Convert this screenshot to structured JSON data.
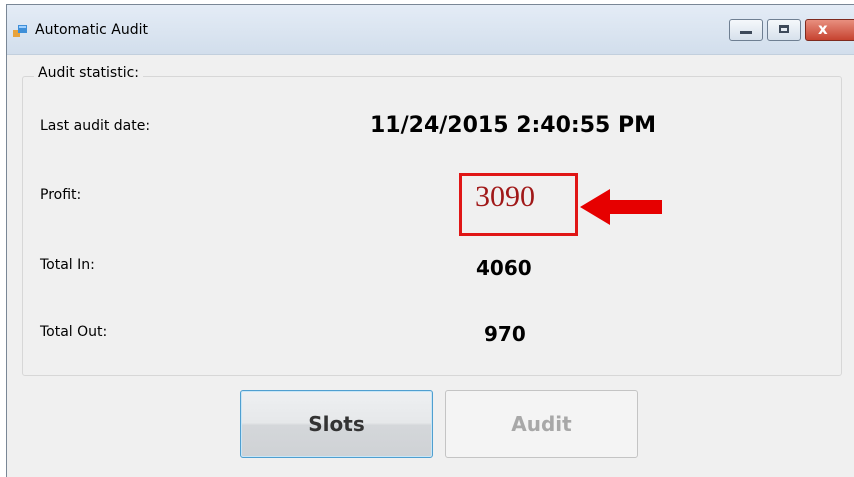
{
  "window": {
    "title": "Automatic Audit"
  },
  "colors": {
    "highlight": "#e01616",
    "profit_text": "#a01818"
  },
  "icons": {
    "app": "app-window-icon",
    "minimize": "minimize-icon",
    "maximize": "maximize-icon",
    "close": "close-icon",
    "arrow": "left-arrow-icon"
  },
  "audit": {
    "group_label": "Audit statistic:",
    "last_audit_label": "Last audit date:",
    "last_audit_value": "11/24/2015 2:40:55 PM",
    "profit_label": "Profit:",
    "profit_value": "3090",
    "total_in_label": "Total In:",
    "total_in_value": "4060",
    "total_out_label": "Total Out:",
    "total_out_value": "970"
  },
  "buttons": {
    "slots": "Slots",
    "audit": "Audit"
  }
}
